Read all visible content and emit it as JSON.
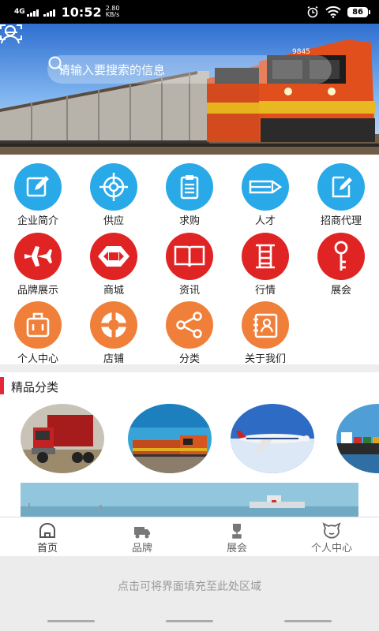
{
  "status": {
    "net": "4G",
    "time": "10:52",
    "speed_val": "2.80",
    "speed_unit": "KB/s",
    "battery": "86"
  },
  "header": {
    "search_placeholder": "请输入要搜索的信息"
  },
  "grid": [
    {
      "label": "企业简介",
      "icon": "edit-icon",
      "color": "#29a9e8"
    },
    {
      "label": "供应",
      "icon": "target-icon",
      "color": "#29a9e8"
    },
    {
      "label": "求购",
      "icon": "clipboard-icon",
      "color": "#29a9e8"
    },
    {
      "label": "人才",
      "icon": "pencil-icon",
      "color": "#29a9e8"
    },
    {
      "label": "招商代理",
      "icon": "note-edit-icon",
      "color": "#29a9e8"
    },
    {
      "label": "品牌展示",
      "icon": "airplane-icon",
      "color": "#e02424"
    },
    {
      "label": "商城",
      "icon": "bank-logo-icon",
      "color": "#e02424"
    },
    {
      "label": "资讯",
      "icon": "book-icon",
      "color": "#e02424"
    },
    {
      "label": "行情",
      "icon": "ladder-icon",
      "color": "#e02424"
    },
    {
      "label": "展会",
      "icon": "key-icon",
      "color": "#e02424"
    },
    {
      "label": "个人中心",
      "icon": "luggage-icon",
      "color": "#f07f3a"
    },
    {
      "label": "店铺",
      "icon": "lifebuoy-icon",
      "color": "#f07f3a"
    },
    {
      "label": "分类",
      "icon": "share-icon",
      "color": "#f07f3a"
    },
    {
      "label": "关于我们",
      "icon": "contact-card-icon",
      "color": "#f07f3a"
    }
  ],
  "section": {
    "title": "精品分类"
  },
  "tabs": [
    {
      "label": "首页",
      "icon": "home-icon",
      "active": true
    },
    {
      "label": "品牌",
      "icon": "truck-icon",
      "active": false
    },
    {
      "label": "展会",
      "icon": "trophy-icon",
      "active": false
    },
    {
      "label": "个人中心",
      "icon": "face-icon",
      "active": false
    }
  ],
  "fill_text": "点击可将界面填充至此处区域",
  "train_number": "9845"
}
